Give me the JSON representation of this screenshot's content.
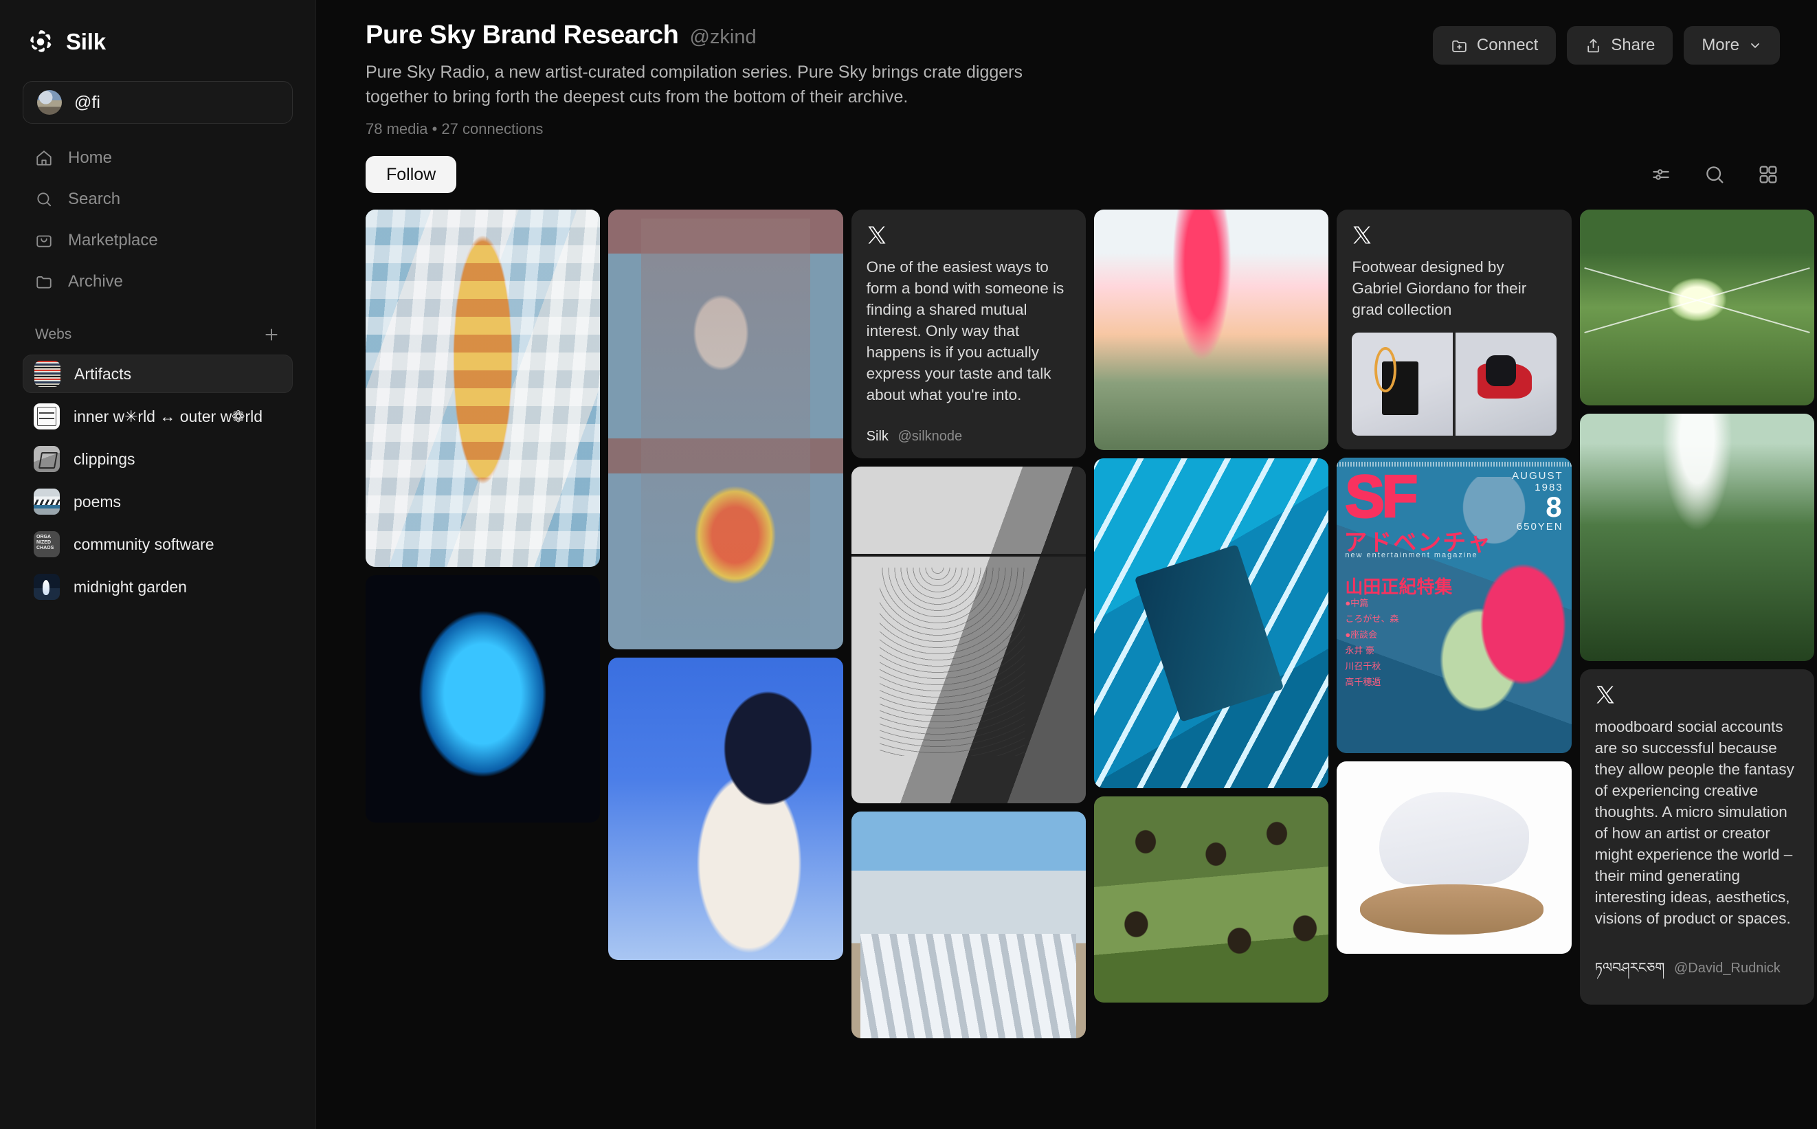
{
  "app": {
    "brand_name": "Silk",
    "logo_icon": "silk-petal-logo"
  },
  "sidebar": {
    "account": {
      "handle": "@fi",
      "avatar_icon": "user-avatar"
    },
    "nav": [
      {
        "label": "Home",
        "icon": "home-icon"
      },
      {
        "label": "Search",
        "icon": "search-icon"
      },
      {
        "label": "Marketplace",
        "icon": "bag-icon"
      },
      {
        "label": "Archive",
        "icon": "folder-icon"
      }
    ],
    "webs_section": {
      "title": "Webs",
      "add_icon": "plus-icon"
    },
    "webs": [
      {
        "label": "Artifacts",
        "active": true,
        "thumb": "wt-artifacts"
      },
      {
        "label": "inner w✳rld ↔ outer w❁rld",
        "active": false,
        "thumb": "wt-inner"
      },
      {
        "label": "clippings",
        "active": false,
        "thumb": "wt-clippings"
      },
      {
        "label": "poems",
        "active": false,
        "thumb": "wt-poems"
      },
      {
        "label": "community software",
        "active": false,
        "thumb": "wt-community"
      },
      {
        "label": "midnight garden",
        "active": false,
        "thumb": "wt-midnight"
      }
    ]
  },
  "header": {
    "title": "Pure Sky Brand Research",
    "handle": "@zkind",
    "description": "Pure Sky Radio, a new artist-curated compilation series. Pure Sky brings crate diggers together to bring forth the deepest cuts from the bottom of their archive.",
    "meta": "78 media • 27 connections",
    "actions": [
      {
        "label": "Connect",
        "icon": "folder-plus-icon"
      },
      {
        "label": "Share",
        "icon": "share-icon"
      },
      {
        "label": "More",
        "icon": "chevron-down-icon"
      }
    ],
    "follow_label": "Follow",
    "tools": [
      {
        "name": "filter-sliders-icon"
      },
      {
        "name": "search-icon"
      },
      {
        "name": "grid-layout-icon"
      }
    ]
  },
  "posts": {
    "moodboard": {
      "source_icon": "x-logo",
      "body": "moodboard social accounts are so successful because they allow people the fantasy of experiencing creative thoughts. A micro simulation of how an artist or creator might experience the world – their mind generating interesting ideas, aesthetics, visions of product or spaces.",
      "author": "ཏལབཤརངཅག",
      "handle": "@David_Rudnick"
    },
    "bond": {
      "source_icon": "x-logo",
      "body": "One of the easiest ways to form a bond with someone is finding a shared mutual interest. Only way that happens is if you actually express your taste and talk about what you're into.",
      "author": "Silk",
      "handle": "@silknode"
    },
    "footwear": {
      "source_icon": "x-logo",
      "body": "Footwear designed by Gabriel Giordano for their grad collection"
    }
  },
  "media": {
    "col1": [
      {
        "name": "ice-pack-cardigan-artwork",
        "art": "a-cardigan"
      },
      {
        "name": "blue-glowing-dress-photo",
        "art": "a-bluelight"
      },
      {
        "name": "hooded-wizard-painting",
        "art": "a-wizard"
      }
    ],
    "col2": [
      {
        "name": "blue-sky-figure-artwork",
        "art": "a-bluejump"
      },
      {
        "name": "spiderweb-barbed-wire-photo",
        "art": "a-spider"
      },
      {
        "name": "snow-mountain-panels-photo",
        "art": "a-mountain"
      }
    ],
    "col3": [
      {
        "name": "pink-smoke-landscape-artwork",
        "art": "a-pinksmoke"
      },
      {
        "name": "cyan-room-figure-artwork",
        "art": "a-cyanroom"
      },
      {
        "name": "running-dogs-field-photo",
        "art": "a-dogs"
      }
    ],
    "col4": [
      {
        "name": "sf-adventure-magazine-cover",
        "art": "a-sfmag"
      },
      {
        "name": "white-studded-sneaker-photo",
        "art": "a-shoe"
      },
      {
        "name": "sun-flare-green-field-photo",
        "art": "a-sunfield"
      },
      {
        "name": "forest-light-rays-photo",
        "art": "a-forestray"
      }
    ],
    "col5": [
      {
        "name": "green-globe-airplane-logo",
        "art": "a-green"
      },
      {
        "name": "gothic-church-trees-photo",
        "art": "a-church"
      }
    ],
    "col6": [
      {
        "name": "desert-plateau-bw-photo",
        "art": "a-desert"
      },
      {
        "name": "snow-forest-sculpture-photo",
        "art": "a-trees"
      },
      {
        "name": "lone-tree-figure-photo",
        "art": "a-lonetree"
      },
      {
        "name": "walking-figure-bw-photo",
        "art": "a-runner"
      },
      {
        "name": "dark-texture-photo",
        "art": "a-dark"
      }
    ]
  },
  "sf_cover": {
    "title": "SF",
    "kana": "アドベンチャ",
    "subtitle": "new entertainment magazine",
    "month_en": "AUGUST",
    "year": "1983",
    "issue": "8",
    "price": "650YEN",
    "feature": "山田正紀特集",
    "lines": "●中篇\nころがせ、森\n●座談会\n永井 豪\n川召千秋\n高千穂遁"
  }
}
